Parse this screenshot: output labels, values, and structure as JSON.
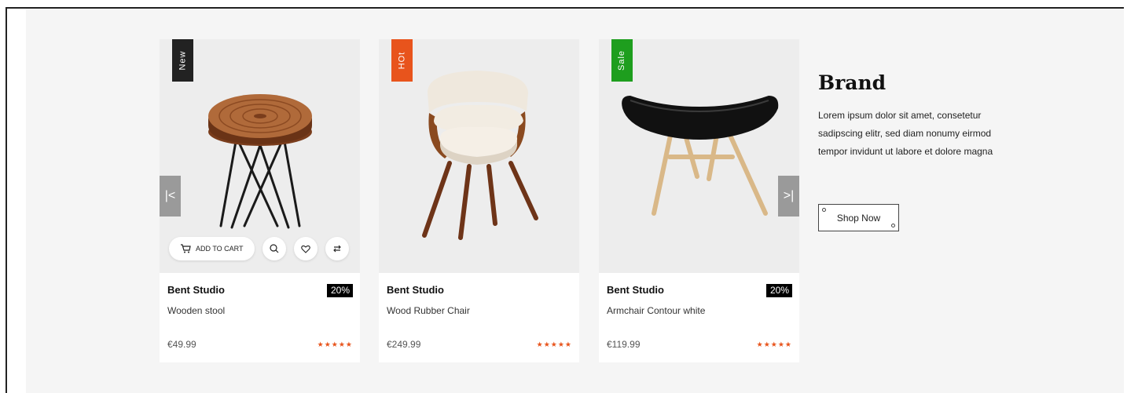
{
  "colors": {
    "tag_new": "#222222",
    "tag_hot": "#e8541c",
    "tag_sale": "#1e9e1e",
    "star": "#e8541c",
    "panel_bg": "#f5f5f5"
  },
  "carousel": {
    "prev_icon": "prev-icon",
    "next_icon": "next-icon",
    "prev_glyph": "|<",
    "next_glyph": ">|"
  },
  "products": [
    {
      "tag": "New",
      "brand": "Bent Studio",
      "name": "Wooden stool",
      "discount": "20%",
      "price": "€49.99",
      "rating": 5,
      "stars": "★★★★★"
    },
    {
      "tag": "HOt",
      "brand": "Bent Studio",
      "name": "Wood Rubber Chair",
      "discount": "",
      "price": "€249.99",
      "rating": 5,
      "stars": "★★★★★"
    },
    {
      "tag": "Sale",
      "brand": "Bent Studio",
      "name": "Armchair Contour white",
      "discount": "20%",
      "price": "€119.99",
      "rating": 5,
      "stars": "★★★★★"
    }
  ],
  "hover_actions": {
    "add_to_cart_label": "ADD TO CART",
    "icons": [
      "cart-icon",
      "search-icon",
      "heart-icon",
      "compare-icon"
    ]
  },
  "promo": {
    "title": "Brand",
    "text": "Lorem ipsum dolor sit amet, consetetur sadipscing elitr, sed diam nonumy eirmod tempor invidunt ut labore et dolore magna",
    "button_label": "Shop Now"
  }
}
